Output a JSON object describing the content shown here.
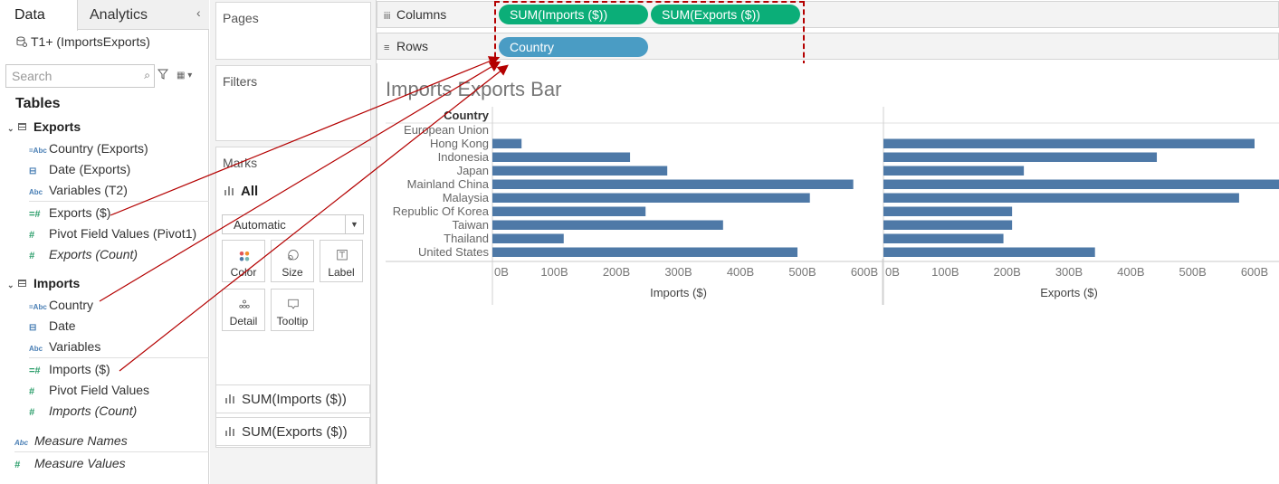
{
  "tabs": {
    "data": "Data",
    "analytics": "Analytics"
  },
  "datasource": "T1+ (ImportsExports)",
  "search": {
    "placeholder": "Search"
  },
  "tables_heading": "Tables",
  "groups": [
    {
      "name": "Exports",
      "fields": [
        {
          "label": "Country (Exports)",
          "icon": "abc-icon"
        },
        {
          "label": "Date (Exports)",
          "icon": "calendar-icon"
        },
        {
          "label": "Variables (T2)",
          "icon": "abc-icon"
        },
        {
          "label": "Exports ($)",
          "icon": "measure-icon"
        },
        {
          "label": "Pivot Field Values (Pivot1)",
          "icon": "measure-icon"
        },
        {
          "label": "Exports (Count)",
          "icon": "measure-icon"
        }
      ]
    },
    {
      "name": "Imports",
      "fields": [
        {
          "label": "Country",
          "icon": "abc-icon"
        },
        {
          "label": "Date",
          "icon": "calendar-icon"
        },
        {
          "label": "Variables",
          "icon": "abc-icon"
        },
        {
          "label": "Imports ($)",
          "icon": "measure-icon"
        },
        {
          "label": "Pivot Field Values",
          "icon": "measure-icon"
        },
        {
          "label": "Imports (Count)",
          "icon": "measure-icon"
        }
      ]
    }
  ],
  "root_fields": [
    {
      "label": "Measure Names",
      "icon": "abc-icon"
    },
    {
      "label": "Measure Values",
      "icon": "measure-icon"
    }
  ],
  "cards": {
    "pages": "Pages",
    "filters": "Filters",
    "marks": "Marks"
  },
  "marks": {
    "all_label": "All",
    "mark_type": "Automatic",
    "buttons": {
      "color": "Color",
      "size": "Size",
      "label": "Label",
      "detail": "Detail",
      "tooltip": "Tooltip"
    },
    "shelves": [
      "SUM(Imports ($))",
      "SUM(Exports ($))"
    ]
  },
  "columns": {
    "label": "Columns",
    "pills": [
      "SUM(Imports ($))",
      "SUM(Exports ($))"
    ]
  },
  "rows": {
    "label": "Rows",
    "pills": [
      "Country"
    ]
  },
  "colors": {
    "measure_pill": "#0bae78",
    "dimension_pill": "#4a9cc4",
    "bar": "#4e79a7",
    "annotation": "#b40000"
  },
  "view": {
    "title": "Imports Exports Bar"
  },
  "chart_data": {
    "type": "bar",
    "orientation": "horizontal",
    "row_header": "Country",
    "categories": [
      "European Union",
      "Hong Kong",
      "Indonesia",
      "Japan",
      "Mainland China",
      "Malaysia",
      "Republic Of Korea",
      "Taiwan",
      "Thailand",
      "United States"
    ],
    "series": [
      {
        "name": "Imports ($)",
        "values": [
          0,
          47,
          222,
          282,
          582,
          512,
          247,
          372,
          115,
          492
        ],
        "ticks": [
          "0B",
          "100B",
          "200B",
          "300B",
          "400B",
          "500B",
          "600B"
        ],
        "xlim": [
          0,
          600
        ]
      },
      {
        "name": "Exports ($)",
        "values": [
          0,
          600,
          442,
          227,
          655,
          575,
          208,
          208,
          194,
          342
        ],
        "ticks": [
          "0B",
          "100B",
          "200B",
          "300B",
          "400B",
          "500B",
          "600B"
        ],
        "xlim": [
          0,
          600
        ]
      }
    ],
    "xlabels": [
      "Imports ($)",
      "Exports ($)"
    ],
    "grid": false
  }
}
